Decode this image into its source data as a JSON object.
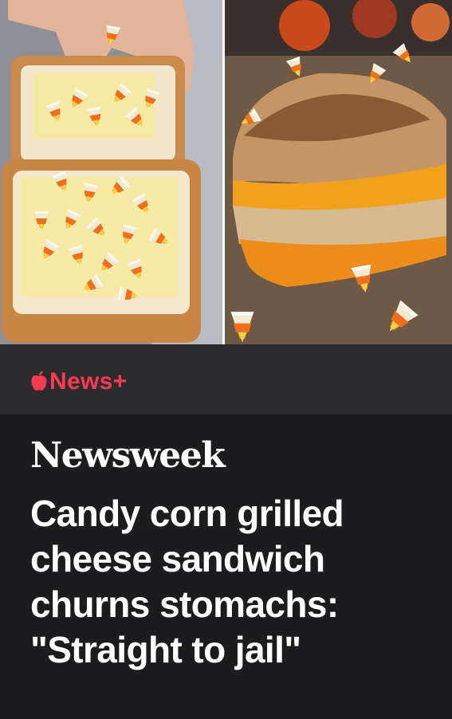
{
  "article": {
    "image": {
      "subject": "candy-corn-grilled-cheese-photos"
    },
    "service": {
      "icon": "apple-logo-icon",
      "label": "News+",
      "color": "#fa3a52"
    },
    "publisher": "Newsweek",
    "headline": "Candy corn grilled cheese sandwich churns stomachs: \"Straight to jail\""
  },
  "colors": {
    "background": "#1c1c1e",
    "strip": "#2c2c2e",
    "text": "#ffffff"
  }
}
